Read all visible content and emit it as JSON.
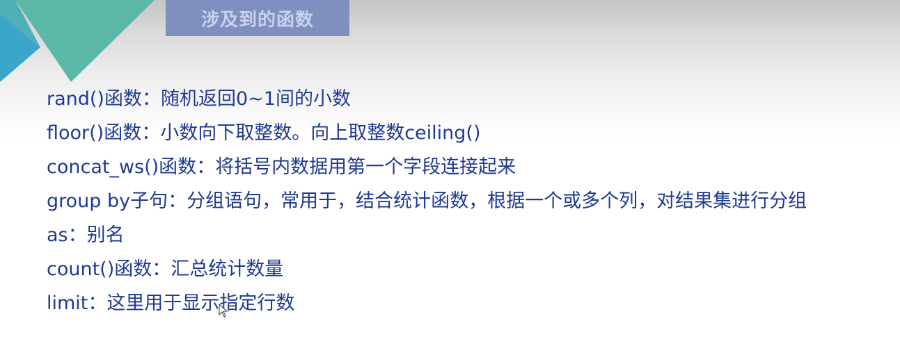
{
  "slide": {
    "title": "涉及到的函数",
    "items": [
      "rand()函数：随机返回0~1间的小数",
      "floor()函数：小数向下取整数。向上取整数ceiling()",
      "concat_ws()函数：将括号内数据用第一个字段连接起来",
      "group by子句：分组语句，常用于，结合统计函数，根据一个或多个列，对结果集进行分组",
      "as：别名",
      "count()函数：汇总统计数量",
      "limit：这里用于显示指定行数"
    ]
  },
  "colors": {
    "title_bg": "#7f8fbf",
    "title_text": "#c9d2ee",
    "body_text": "#1f3a93",
    "deco_blue": "#3aa6c9",
    "deco_teal": "#5bb8a8"
  },
  "icons": {
    "cursor": "mouse-pointer-icon"
  }
}
